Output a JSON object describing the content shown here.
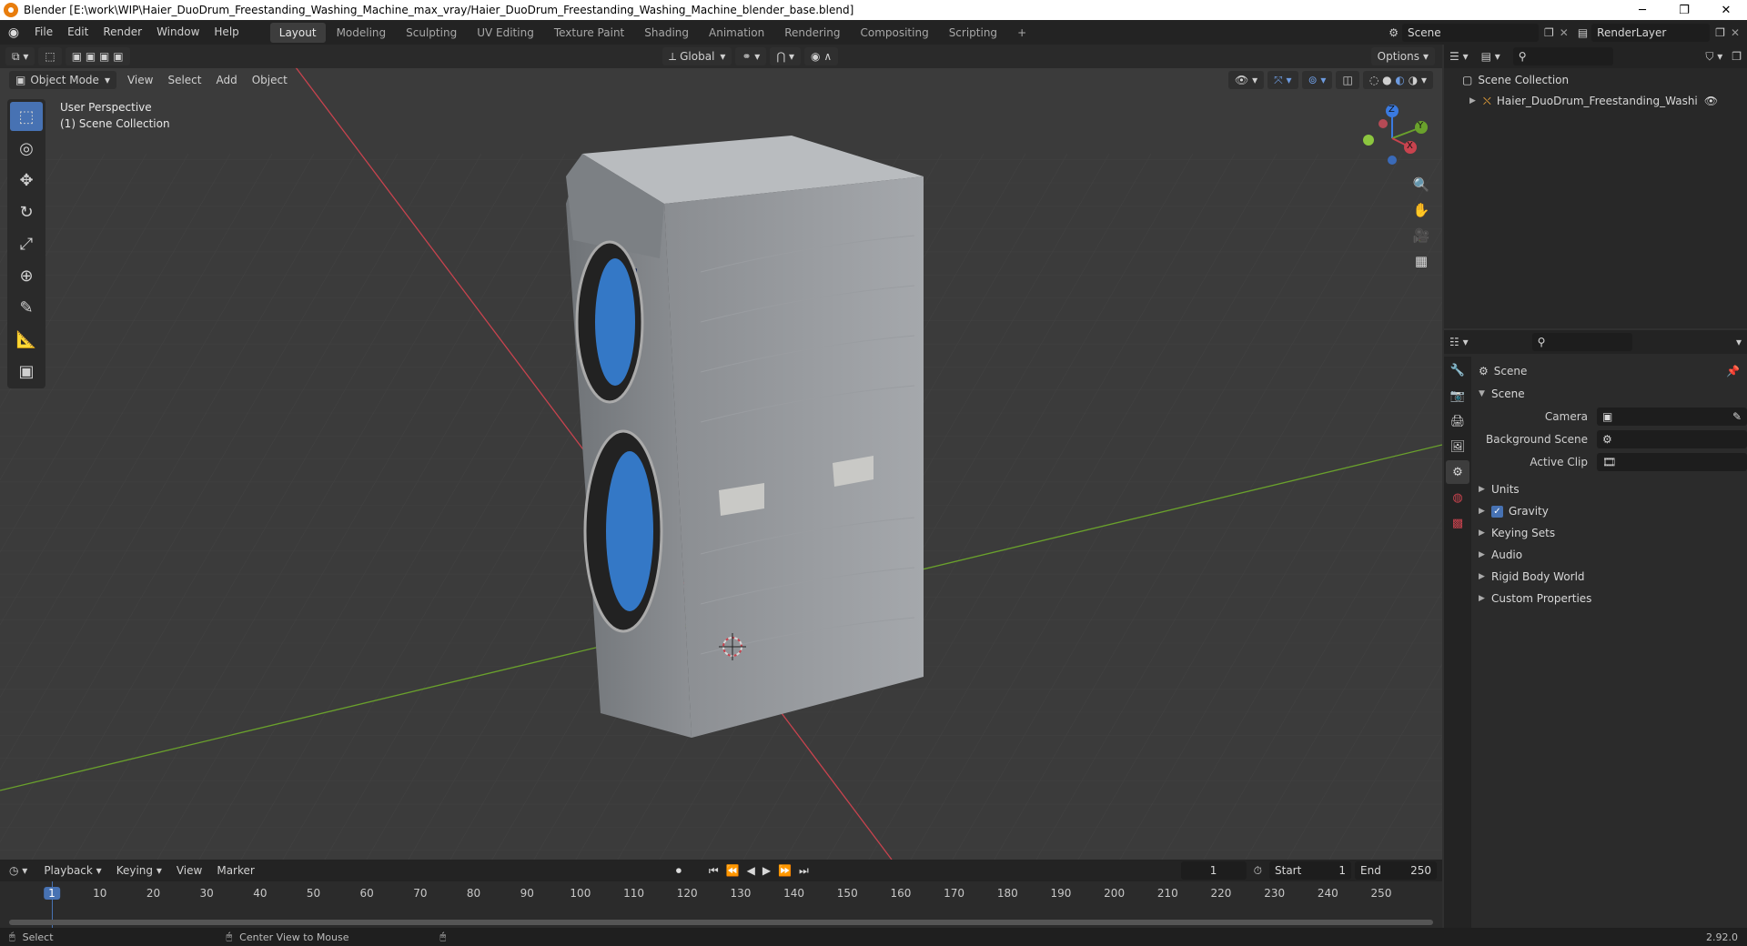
{
  "window": {
    "title": "Blender [E:\\work\\WIP\\Haier_DuoDrum_Freestanding_Washing_Machine_max_vray/Haier_DuoDrum_Freestanding_Washing_Machine_blender_base.blend]",
    "minimize": "─",
    "maximize": "❐",
    "close": "✕"
  },
  "menu": [
    "File",
    "Edit",
    "Render",
    "Window",
    "Help"
  ],
  "workspaces": {
    "active": "Layout",
    "tabs": [
      "Layout",
      "Modeling",
      "Sculpting",
      "UV Editing",
      "Texture Paint",
      "Shading",
      "Animation",
      "Rendering",
      "Compositing",
      "Scripting"
    ],
    "add": "+"
  },
  "scene_selector": {
    "value": "Scene"
  },
  "renderlayer_selector": {
    "value": "RenderLayer"
  },
  "viewport": {
    "transform_orientation": "Global",
    "options_label": "Options",
    "mode": "Object Mode",
    "menus": [
      "View",
      "Select",
      "Add",
      "Object"
    ],
    "overlay_text_line1": "User Perspective",
    "overlay_text_line2": "(1) Scene Collection",
    "gizmo": {
      "z": "Z",
      "y": "Y",
      "x": "X"
    }
  },
  "outliner": {
    "root": "Scene Collection",
    "items": [
      "Haier_DuoDrum_Freestanding_Washing_Mac"
    ]
  },
  "properties": {
    "header": "Scene",
    "section": "Scene",
    "fields": [
      {
        "label": "Camera",
        "value": ""
      },
      {
        "label": "Background Scene",
        "value": ""
      },
      {
        "label": "Active Clip",
        "value": ""
      }
    ],
    "panels": [
      {
        "label": "Units",
        "checkbox": false
      },
      {
        "label": "Gravity",
        "checkbox": true
      },
      {
        "label": "Keying Sets",
        "checkbox": false
      },
      {
        "label": "Audio",
        "checkbox": false
      },
      {
        "label": "Rigid Body World",
        "checkbox": false
      },
      {
        "label": "Custom Properties",
        "checkbox": false
      }
    ]
  },
  "timeline": {
    "menus": [
      "Playback",
      "Keying",
      "View",
      "Marker"
    ],
    "current_frame": "1",
    "start_label": "Start",
    "start": "1",
    "end_label": "End",
    "end": "250",
    "ticks": [
      "1",
      "10",
      "20",
      "30",
      "40",
      "50",
      "60",
      "70",
      "80",
      "90",
      "100",
      "110",
      "120",
      "130",
      "140",
      "150",
      "160",
      "170",
      "180",
      "190",
      "200",
      "210",
      "220",
      "230",
      "240",
      "250"
    ]
  },
  "status": {
    "left": "Select",
    "middle": "Center View to Mouse",
    "version": "2.92.0"
  },
  "colors": {
    "accent": "#4772b3",
    "x_axis": "#c8434e",
    "y_axis": "#6aa12c",
    "z_axis": "#3a7ae0"
  }
}
